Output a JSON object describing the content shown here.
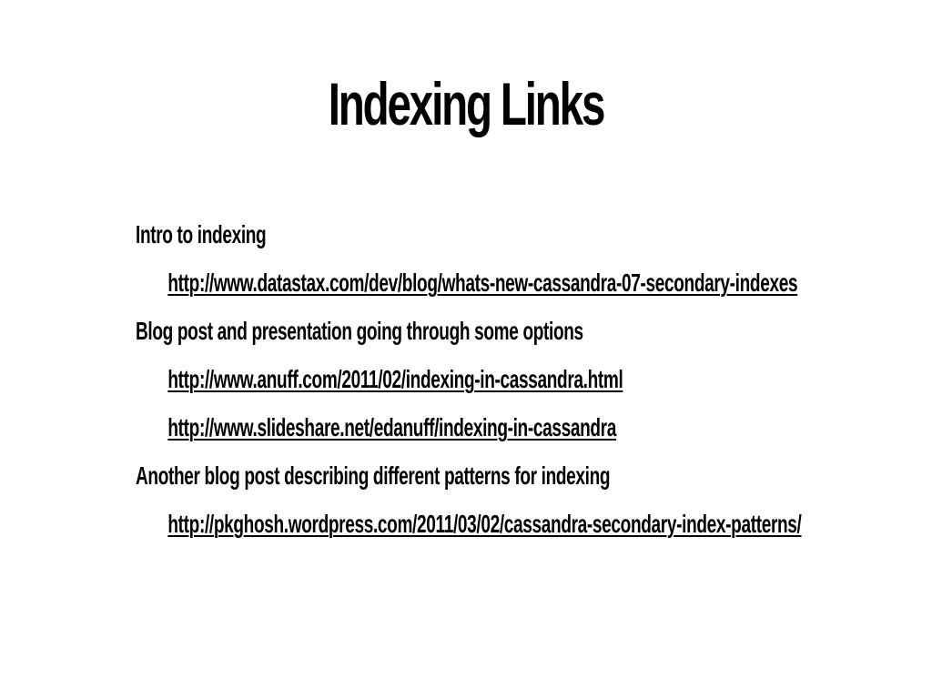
{
  "slide": {
    "title": "Indexing Links",
    "sections": [
      {
        "heading": "Intro to indexing",
        "links": [
          "http://www.datastax.com/dev/blog/whats-new-cassandra-07-secondary-indexes"
        ]
      },
      {
        "heading": "Blog post and presentation going through some options",
        "links": [
          "http://www.anuff.com/2011/02/indexing-in-cassandra.html",
          "http://www.slideshare.net/edanuff/indexing-in-cassandra"
        ]
      },
      {
        "heading": "Another blog post describing different patterns for indexing",
        "links": [
          "http://pkghosh.wordpress.com/2011/03/02/cassandra-secondary-index-patterns/"
        ]
      }
    ]
  }
}
